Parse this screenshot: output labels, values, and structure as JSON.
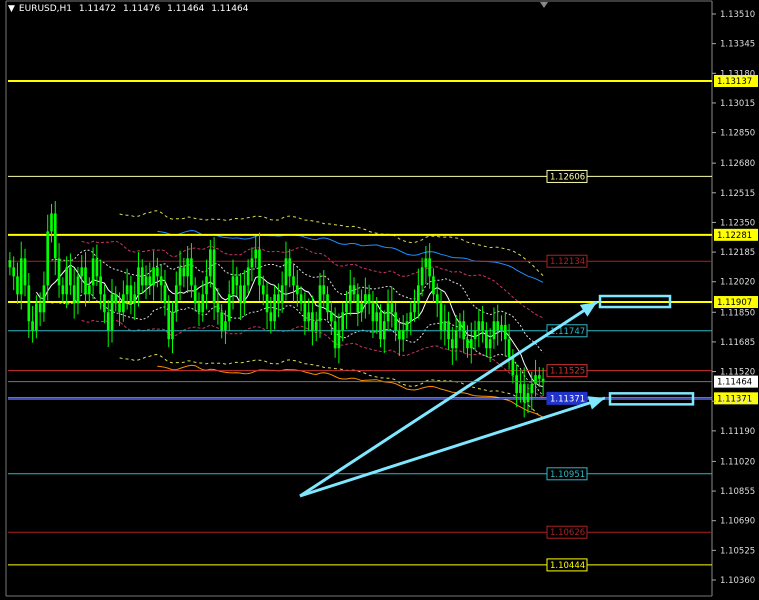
{
  "header": {
    "symbol": "EURUSD,H1",
    "open": "1.11472",
    "high": "1.11476",
    "low": "1.11464",
    "close": "1.11464"
  },
  "colors": {
    "background": "#000000",
    "candle": "#00ff00",
    "yellow_line": "#ffff00",
    "arrow": "#7fe7ff",
    "blue_line": "#1e90ff",
    "orange_line": "#ff8c00",
    "red_line": "#cc2222",
    "teal_line": "#2fb7c6"
  },
  "chart_data": {
    "type": "line",
    "yaxis_ticks": [
      "1.13510",
      "1.13345",
      "1.13180",
      "1.13015",
      "1.12850",
      "1.12680",
      "1.12515",
      "1.12350",
      "1.12185",
      "1.12020",
      "1.11850",
      "1.11685",
      "1.11520",
      "1.11355",
      "1.11190",
      "1.11020",
      "1.10855",
      "1.10690",
      "1.10525",
      "1.10360"
    ],
    "ylim": [
      1.1033,
      1.1359
    ],
    "current_price": {
      "label": "1.11464",
      "value": 1.11464
    },
    "levels": [
      {
        "label": "1.13137",
        "value": 1.13137,
        "color": "#ffff00",
        "style": "thick",
        "tag": "axis"
      },
      {
        "label": "1.12606",
        "value": 1.12606,
        "color": "#ffffaa",
        "style": "thin",
        "tag": "chart"
      },
      {
        "label": "1.12281",
        "value": 1.12281,
        "color": "#ffff00",
        "style": "thick",
        "tag": "axis"
      },
      {
        "label": "1.12134",
        "value": 1.12134,
        "color": "#aa2222",
        "style": "thin",
        "tag": "chart"
      },
      {
        "label": "1.11907",
        "value": 1.11907,
        "color": "#ffff00",
        "style": "thick",
        "tag": "axis"
      },
      {
        "label": "1.11747",
        "value": 1.11747,
        "color": "#2fb7c6",
        "style": "thin",
        "tag": "chart"
      },
      {
        "label": "1.11525",
        "value": 1.11525,
        "color": "#cc3333",
        "style": "thin",
        "tag": "chart"
      },
      {
        "label": "1.11371",
        "value": 1.11371,
        "color": "#ffff00",
        "style": "thick",
        "tag": "axis"
      },
      {
        "label": "1.11371",
        "value": 1.11371,
        "color": "#2233cc",
        "style": "thin",
        "tag": "chart"
      },
      {
        "label": "1.10951",
        "value": 1.10951,
        "color": "#2fb7c6",
        "style": "thin",
        "tag": "chart"
      },
      {
        "label": "1.10626",
        "value": 1.10626,
        "color": "#aa2222",
        "style": "thin",
        "tag": "chart"
      },
      {
        "label": "1.10444",
        "value": 1.10444,
        "color": "#ffff00",
        "style": "thin",
        "tag": "chart"
      }
    ],
    "closes": [
      1.121,
      1.1205,
      1.1195,
      1.1215,
      1.12,
      1.118,
      1.1175,
      1.119,
      1.1185,
      1.12,
      1.123,
      1.124,
      1.1215,
      1.12,
      1.1195,
      1.121,
      1.12,
      1.119,
      1.1205,
      1.121,
      1.1195,
      1.12,
      1.1215,
      1.1205,
      1.1195,
      1.1185,
      1.1175,
      1.1195,
      1.119,
      1.1185,
      1.1195,
      1.12,
      1.119,
      1.1195,
      1.121,
      1.12,
      1.1205,
      1.12,
      1.121,
      1.1205,
      1.12,
      1.119,
      1.117,
      1.1185,
      1.12,
      1.121,
      1.1205,
      1.1215,
      1.12,
      1.119,
      1.1185,
      1.1195,
      1.1205,
      1.122,
      1.119,
      1.1185,
      1.1175,
      1.118,
      1.1195,
      1.1205,
      1.12,
      1.119,
      1.12,
      1.121,
      1.1215,
      1.122,
      1.12,
      1.1195,
      1.1185,
      1.118,
      1.1195,
      1.119,
      1.12,
      1.1215,
      1.1205,
      1.12,
      1.1195,
      1.119,
      1.118,
      1.1185,
      1.1175,
      1.118,
      1.12,
      1.1195,
      1.1185,
      1.118,
      1.1165,
      1.1175,
      1.1185,
      1.119,
      1.12,
      1.1195,
      1.1185,
      1.119,
      1.1195,
      1.119,
      1.118,
      1.1185,
      1.117,
      1.118,
      1.119,
      1.1185,
      1.1175,
      1.117,
      1.1175,
      1.118,
      1.1185,
      1.119,
      1.12,
      1.121,
      1.1215,
      1.1205,
      1.1195,
      1.119,
      1.1175,
      1.118,
      1.117,
      1.1165,
      1.1175,
      1.118,
      1.117,
      1.1165,
      1.117,
      1.1175,
      1.118,
      1.1175,
      1.1165,
      1.117,
      1.118,
      1.1175,
      1.1178,
      1.117,
      1.116,
      1.115,
      1.114,
      1.1145,
      1.1135,
      1.114,
      1.1145,
      1.115,
      1.1148,
      1.1146
    ]
  }
}
